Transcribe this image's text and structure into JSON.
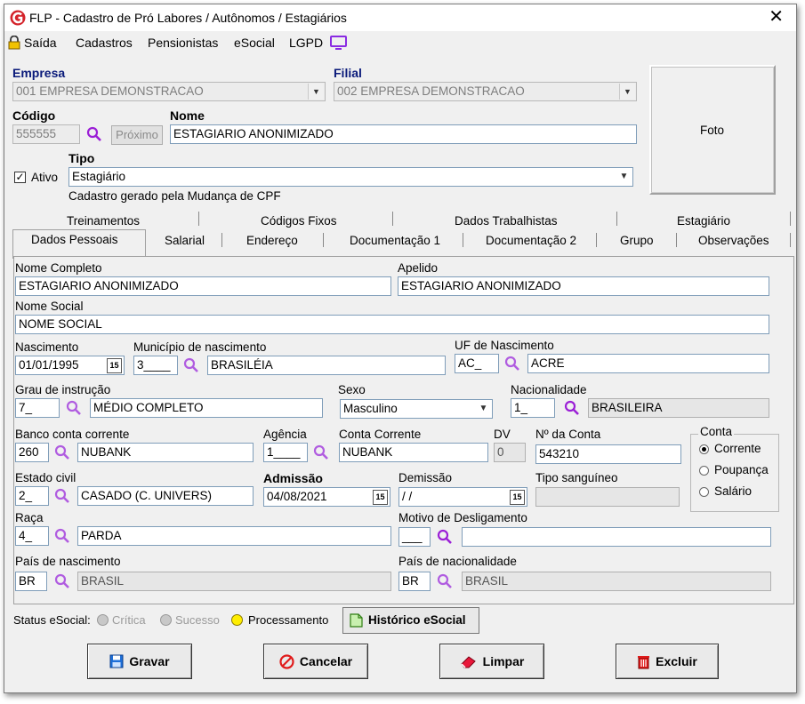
{
  "window": {
    "title": "FLP - Cadastro de Pró Labores / Autônomos / Estagiários"
  },
  "menu": {
    "exit": "Saída",
    "items": [
      "Cadastros",
      "Pensionistas",
      "eSocial",
      "LGPD"
    ]
  },
  "header": {
    "empresa_label": "Empresa",
    "empresa_value": "001 EMPRESA DEMONSTRACAO",
    "filial_label": "Filial",
    "filial_value": "002 EMPRESA DEMONSTRACAO",
    "codigo_label": "Código",
    "codigo_value": "555555",
    "proximo_label": "Próximo",
    "nome_label": "Nome",
    "nome_value": "ESTAGIARIO ANONIMIZADO",
    "ativo_label": "Ativo",
    "ativo_checked": true,
    "tipo_label": "Tipo",
    "tipo_value": "Estagiário",
    "note": "Cadastro gerado pela Mudança de CPF",
    "foto_label": "Foto"
  },
  "tabs_row1": [
    "Treinamentos",
    "Códigos Fixos",
    "Dados Trabalhistas",
    "Estagiário"
  ],
  "tabs_row2": [
    "Dados Pessoais",
    "Salarial",
    "Endereço",
    "Documentação 1",
    "Documentação 2",
    "Grupo",
    "Observações"
  ],
  "form": {
    "nome_completo_label": "Nome Completo",
    "nome_completo": "ESTAGIARIO ANONIMIZADO",
    "apelido_label": "Apelido",
    "apelido": "ESTAGIARIO  ANONIMIZADO",
    "nome_social_label": "Nome Social",
    "nome_social": "NOME SOCIAL",
    "nascimento_label": "Nascimento",
    "nascimento": "01/01/1995",
    "municipio_label": "Município de nascimento",
    "municipio_code": "3____",
    "municipio_name": "BRASILÉIA",
    "uf_label": "UF de Nascimento",
    "uf_code": "AC_",
    "uf_name": "ACRE",
    "grau_label": "Grau de instrução",
    "grau_code": "7_",
    "grau_name": "MÉDIO COMPLETO",
    "sexo_label": "Sexo",
    "sexo": "Masculino",
    "nacionalidade_label": "Nacionalidade",
    "nacionalidade_code": "1_",
    "nacionalidade_name": "BRASILEIRA",
    "banco_label": "Banco conta corrente",
    "banco_code": "260",
    "banco_name": "NUBANK",
    "agencia_label": "Agência",
    "agencia": "1____",
    "conta_corrente_label": "Conta Corrente",
    "conta_corrente": "NUBANK",
    "dv_label": "DV",
    "dv": "0",
    "numero_conta_label": "Nº da Conta",
    "numero_conta": "543210",
    "conta_group_label": "Conta",
    "conta_options": [
      "Corrente",
      "Poupança",
      "Salário"
    ],
    "conta_selected": "Corrente",
    "estado_civil_label": "Estado civil",
    "estado_civil_code": "2_",
    "estado_civil_name": "CASADO (C. UNIVERS)",
    "admissao_label": "Admissão",
    "admissao": "04/08/2021",
    "demissao_label": "Demissão",
    "demissao": " / /",
    "tipo_sanguineo_label": "Tipo sanguíneo",
    "tipo_sanguineo": "",
    "raca_label": "Raça",
    "raca_code": "4_",
    "raca_name": "PARDA",
    "motivo_label": "Motivo de Desligamento",
    "motivo_code": "___",
    "motivo_name": "",
    "pais_nasc_label": "País de nascimento",
    "pais_nasc_code": "BR",
    "pais_nasc_name": "BRASIL",
    "pais_nac_label": "País de nacionalidade",
    "pais_nac_code": "BR",
    "pais_nac_name": "BRASIL"
  },
  "status": {
    "label": "Status eSocial:",
    "critica": "Crítica",
    "sucesso": "Sucesso",
    "processamento": "Processamento",
    "historico": "Histórico eSocial",
    "colors": {
      "critica": "#c8c8c8",
      "sucesso": "#c8c8c8",
      "processamento": "#ffee00"
    }
  },
  "actions": {
    "gravar": "Gravar",
    "cancelar": "Cancelar",
    "limpar": "Limpar",
    "excluir": "Excluir"
  },
  "colors": {
    "accent_blue": "#0a1a7a",
    "magnifier": "#9b1fd6",
    "logo_red": "#d4232a",
    "lgpd": "#8a2be2"
  }
}
